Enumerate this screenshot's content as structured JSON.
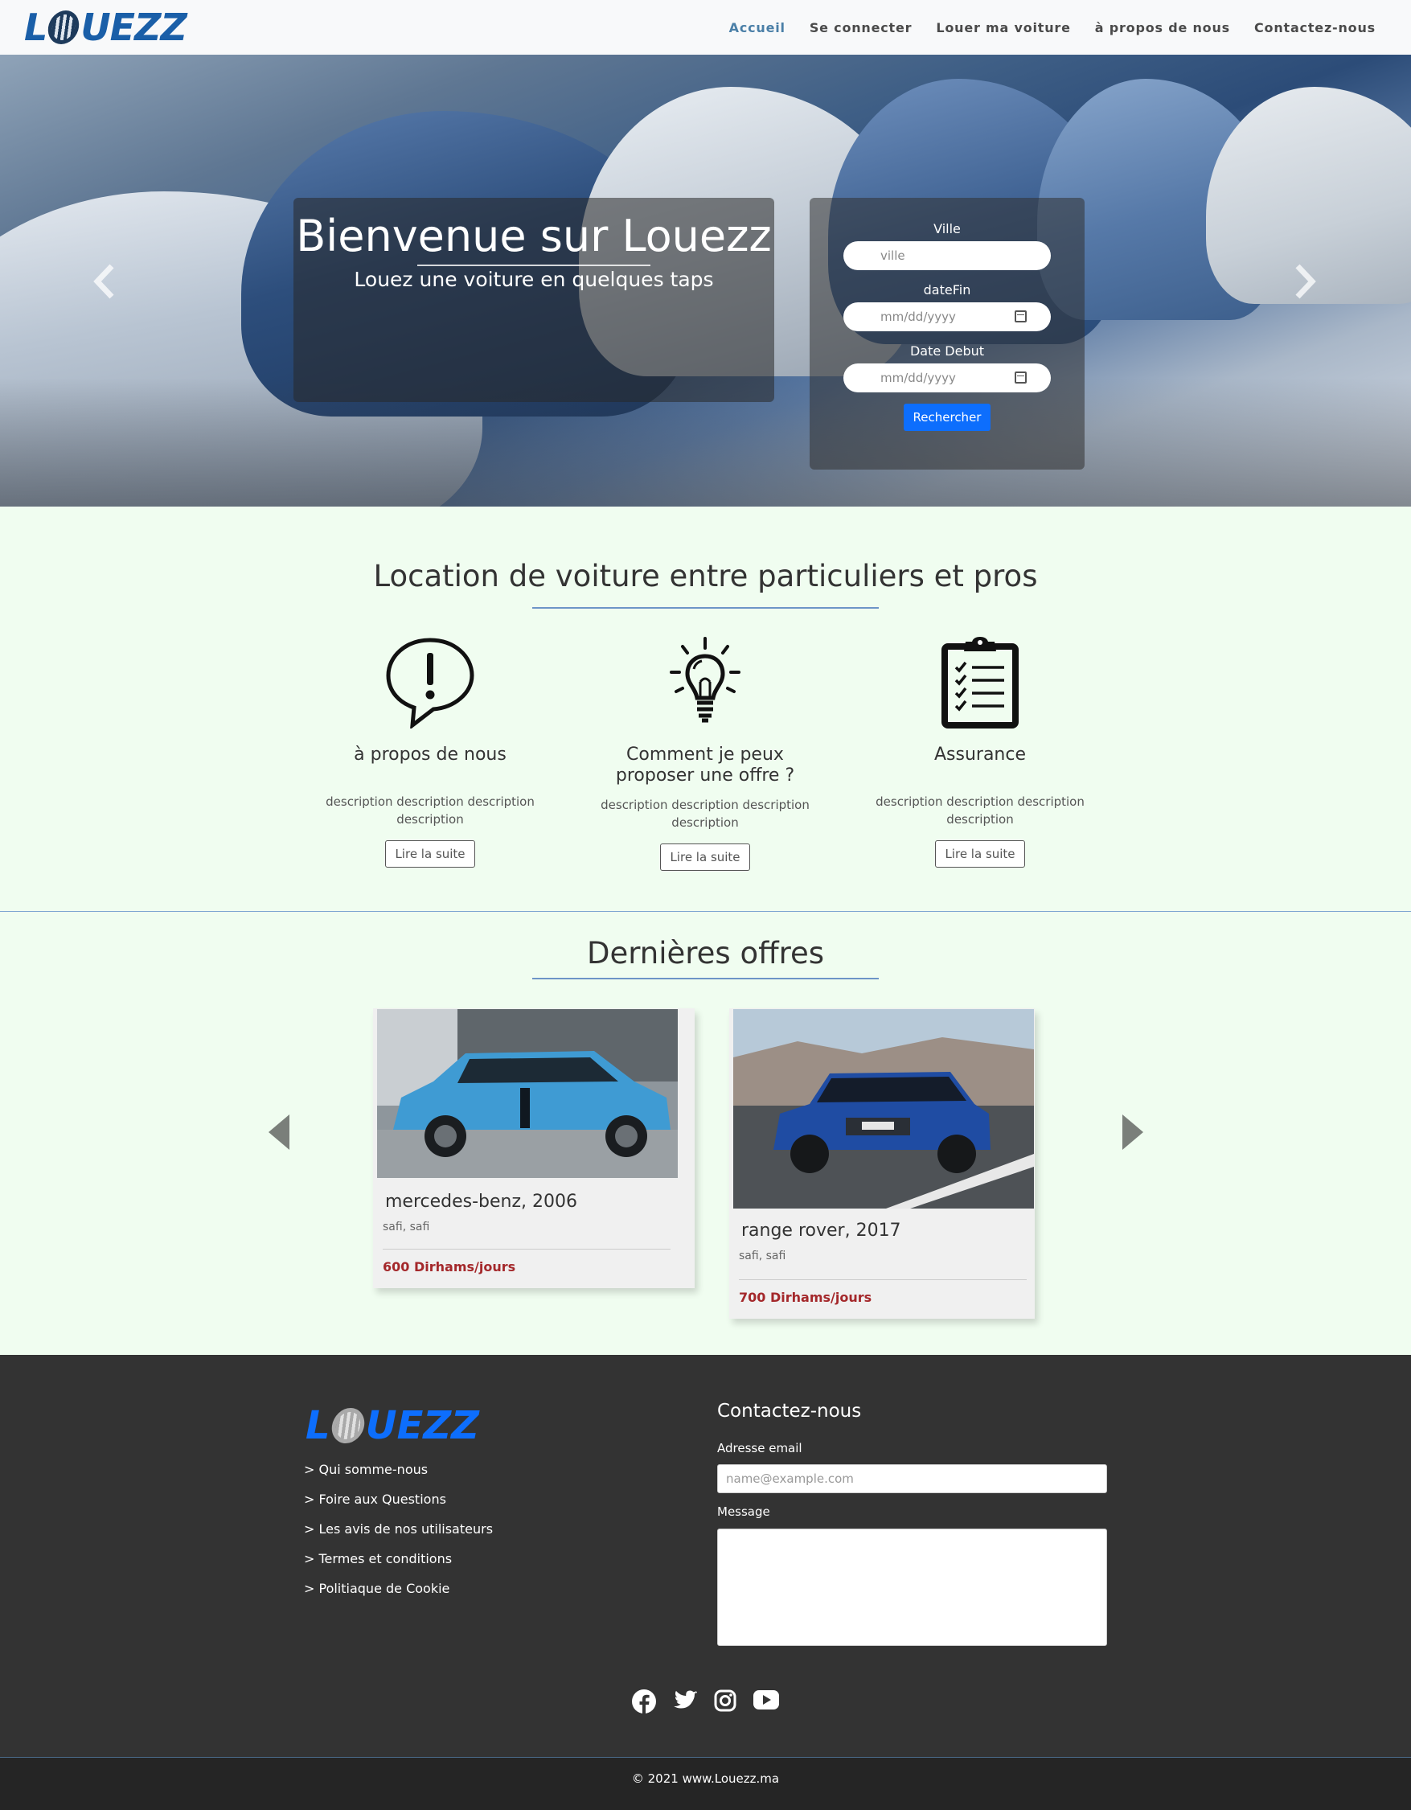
{
  "navbar": {
    "logo_text_1": "L",
    "logo_text_2": "UEZZ",
    "links": [
      "Accueil",
      "Se connecter",
      "Louer ma voiture",
      "à propos de nous",
      "Contactez-nous"
    ]
  },
  "hero": {
    "title": "Bienvenue sur Louezz",
    "subtitle": "Louez une voiture en quelques taps",
    "prev_icon": "chevron-left-icon",
    "next_icon": "chevron-right-icon",
    "search": {
      "city_label": "Ville",
      "city_placeholder": "ville",
      "end_label": "dateFin",
      "end_placeholder": "mm/dd/yyyy",
      "start_label": "Date Debut",
      "start_placeholder": "mm/dd/yyyy",
      "button": "Rechercher"
    }
  },
  "features": {
    "title": "Location de voiture entre particuliers et pros",
    "items": [
      {
        "icon": "speech-bubble-exclamation-icon",
        "title": "à propos de nous",
        "desc": "description description description description",
        "button": "Lire la suite"
      },
      {
        "icon": "lightbulb-icon",
        "title": "Comment je peux proposer une offre ?",
        "desc": "description description description description",
        "button": "Lire la suite"
      },
      {
        "icon": "clipboard-checklist-icon",
        "title": "Assurance",
        "desc": "description description description description",
        "button": "Lire la suite"
      }
    ]
  },
  "offers": {
    "title": "Dernières offres",
    "items": [
      {
        "title": "mercedes-benz, 2006",
        "location": "safi, safi",
        "price": "600 Dirhams/jours"
      },
      {
        "title": "range rover, 2017",
        "location": "safi, safi",
        "price": "700 Dirhams/jours"
      }
    ]
  },
  "footer": {
    "logo_text_1": "L",
    "logo_text_2": "UEZZ",
    "links": [
      "> Qui somme-nous",
      "> Foire aux Questions",
      "> Les avis de nos utilisateurs",
      "> Termes et conditions",
      "> Politiaque de Cookie"
    ],
    "contact_title": "Contactez-nous",
    "email_label": "Adresse email",
    "email_placeholder": "name@example.com",
    "message_label": "Message",
    "socials": [
      "facebook-icon",
      "twitter-icon",
      "instagram-icon",
      "youtube-icon"
    ],
    "copyright": "© 2021 www.Louezz.ma"
  },
  "colors": {
    "brand_blue": "#1a5fa8",
    "accent": "#0d6efd",
    "price": "#a4282b",
    "footer_bg": "#333333",
    "page_bg": "#f0fdf0"
  }
}
